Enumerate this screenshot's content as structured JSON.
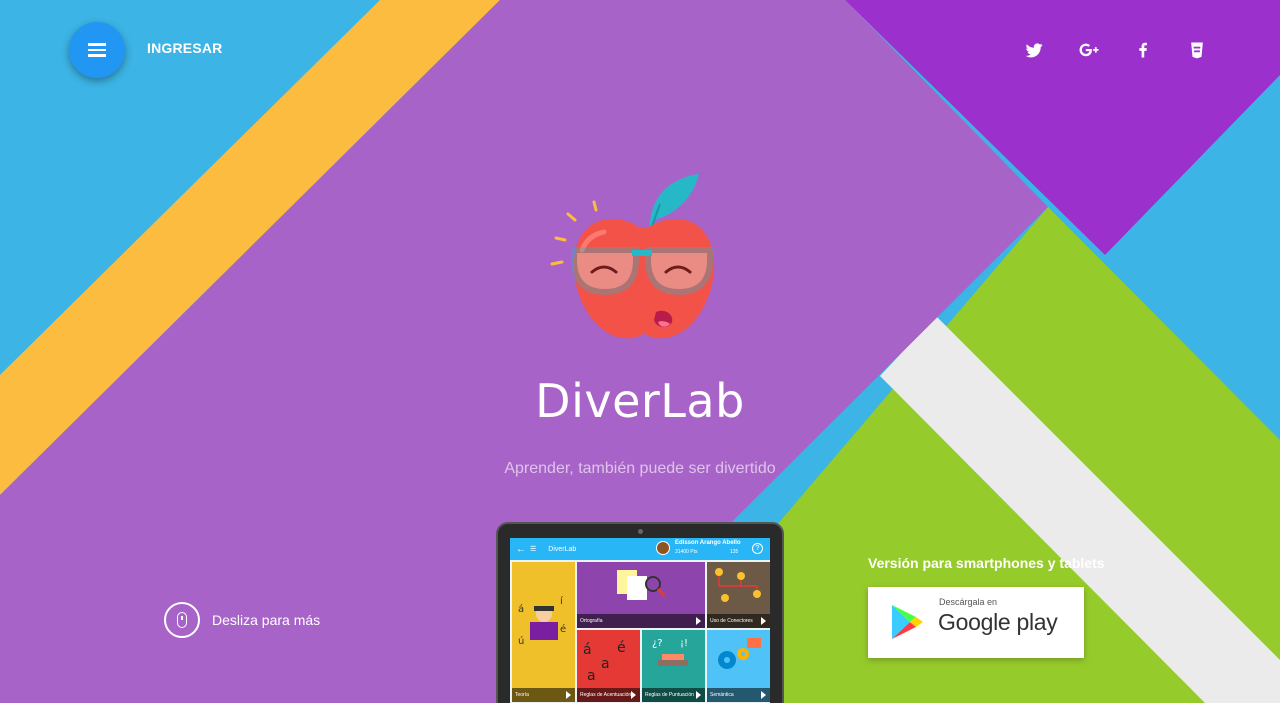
{
  "header": {
    "menu_icon": "hamburger-menu-icon",
    "login_label": "INGRESAR"
  },
  "social": [
    {
      "icon": "twitter-icon",
      "name": "Twitter"
    },
    {
      "icon": "google-plus-icon",
      "name": "Google+"
    },
    {
      "icon": "facebook-icon",
      "name": "Facebook"
    },
    {
      "icon": "blog-icon",
      "name": "Blog"
    }
  ],
  "hero": {
    "brand": "DiverLab",
    "tagline": "Aprender, también puede ser divertido"
  },
  "scroll_hint": {
    "icon": "mouse-icon",
    "label": "Desliza para más"
  },
  "store": {
    "version_text": "Versión para smartphones y tablets",
    "badge_small": "Descárgala en",
    "badge_big": "Google play",
    "badge_icon": "google-play-icon"
  },
  "app_preview": {
    "app_title": "DiverLab",
    "user_name": "Edisson Arango Abello",
    "user_points": "31400 Pts",
    "coins": "135",
    "tiles": [
      {
        "label": "Teoría",
        "color": "#f0c02a"
      },
      {
        "label": "Ortografía",
        "color": "#8e44ad"
      },
      {
        "label": "Uso de Conectores",
        "color": "#6d5a46"
      },
      {
        "label": "Reglas de Acentuación",
        "color": "#e53935"
      },
      {
        "label": "Reglas de Puntuación",
        "color": "#26a69a"
      },
      {
        "label": "Semántica",
        "color": "#4fc3f7"
      }
    ]
  },
  "colors": {
    "blue_bg": "#3cb4e5",
    "purple_main": "#a863c9",
    "purple_dark": "#9b30cd",
    "yellow": "#fbbc3f",
    "green": "#96cb2c",
    "light_gray": "#ebebeb",
    "menu_button": "#2196f3"
  }
}
